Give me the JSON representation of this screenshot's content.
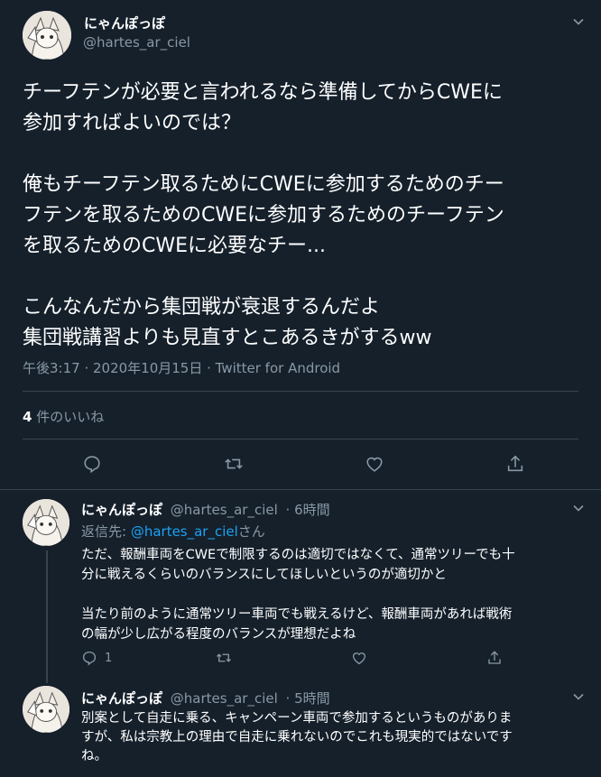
{
  "main": {
    "author_name": "にゃんぽっぽ",
    "author_handle": "@hartes_ar_ciel",
    "text": "チーフテンが必要と言われるなら準備してからCWEに\n参加すればよいのでは？\n\n俺もチーフテン取るためにCWEに参加するためのチー\nフテンを取るためのCWEに参加するためのチーフテン\nを取るためのCWEに必要なチー...\n\nこんなんだから集団戦が衰退するんだよ\n集団戦講習よりも見直すとこあるきがするww",
    "timestamp": "午後3:17 · 2020年10月15日 · Twitter for Android",
    "likes_count": "4",
    "likes_label": " 件のいいね",
    "icons": {
      "reply": "reply-icon",
      "retweet": "retweet-icon",
      "like": "heart-icon",
      "share": "share-icon",
      "menu": "chevron-down-icon"
    }
  },
  "replies": [
    {
      "author_name": "にゃんぽっぽ",
      "author_handle": "@hartes_ar_ciel",
      "time": "· 6時間",
      "reply_to_prefix": "返信先: ",
      "reply_to_handle": "@hartes_ar_ciel",
      "reply_to_suffix": "さん",
      "text": "ただ、報酬車両をCWEで制限するのは適切ではなくて、通常ツリーでも十\n分に戦えるくらいのバランスにしてほしいというのが適切かと\n\n当たり前のように通常ツリー車両でも戦えるけど、報酬車両があれば戦術\nの幅が少し広がる程度のバランスが理想だよね",
      "reply_count": "1"
    },
    {
      "author_name": "にゃんぽっぽ",
      "author_handle": "@hartes_ar_ciel",
      "time": "· 5時間",
      "text": "別案として自走に乗る、キャンペーン車両で参加するというものがありま\nすが、私は宗教上の理由で自走に乗れないのでこれも現実的ではないです\nね。"
    }
  ],
  "colors": {
    "background": "#15202b",
    "separator": "#38444d",
    "muted": "#8899a6",
    "link": "#1da1f2"
  }
}
